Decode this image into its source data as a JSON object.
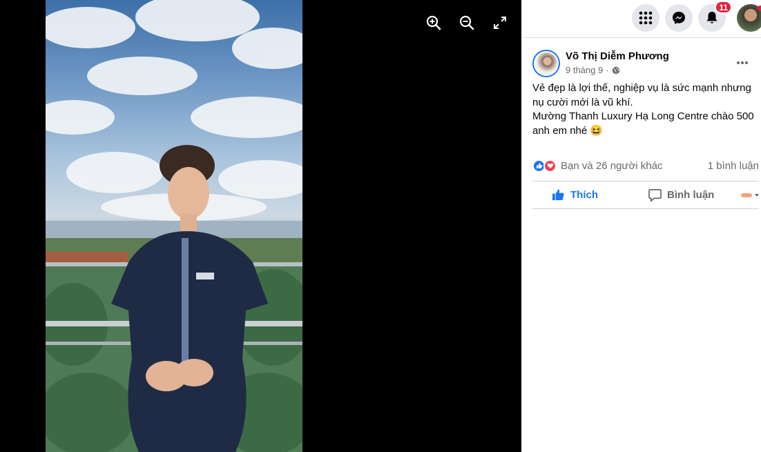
{
  "viewer": {
    "zoom_in_icon": "zoom-in-icon",
    "zoom_out_icon": "zoom-out-icon",
    "fullscreen_icon": "fullscreen-icon"
  },
  "topbar": {
    "menu_icon": "grid-menu-icon",
    "messenger_icon": "messenger-icon",
    "notifications_icon": "bell-icon",
    "notifications_count": "11"
  },
  "post": {
    "author": "Võ Thị Diễm Phương",
    "date": "9 tháng 9",
    "separator": "·",
    "privacy_icon": "globe-icon",
    "text_lines": [
      "Vẻ đẹp là lợi thế, nghiệp vụ là sức mạnh nhưng nụ cười mới là vũ khí.",
      "Mường Thanh Luxury Hạ Long Centre chào 500 anh em nhé 😆"
    ],
    "reactions_text": "Bạn và 26 người khác",
    "comments_text": "1 bình luận",
    "like_label": "Thích",
    "comment_label": "Bình luận"
  },
  "colors": {
    "accent": "#1877f2",
    "badge": "#e41e3f",
    "secondary_text": "#65676b"
  }
}
